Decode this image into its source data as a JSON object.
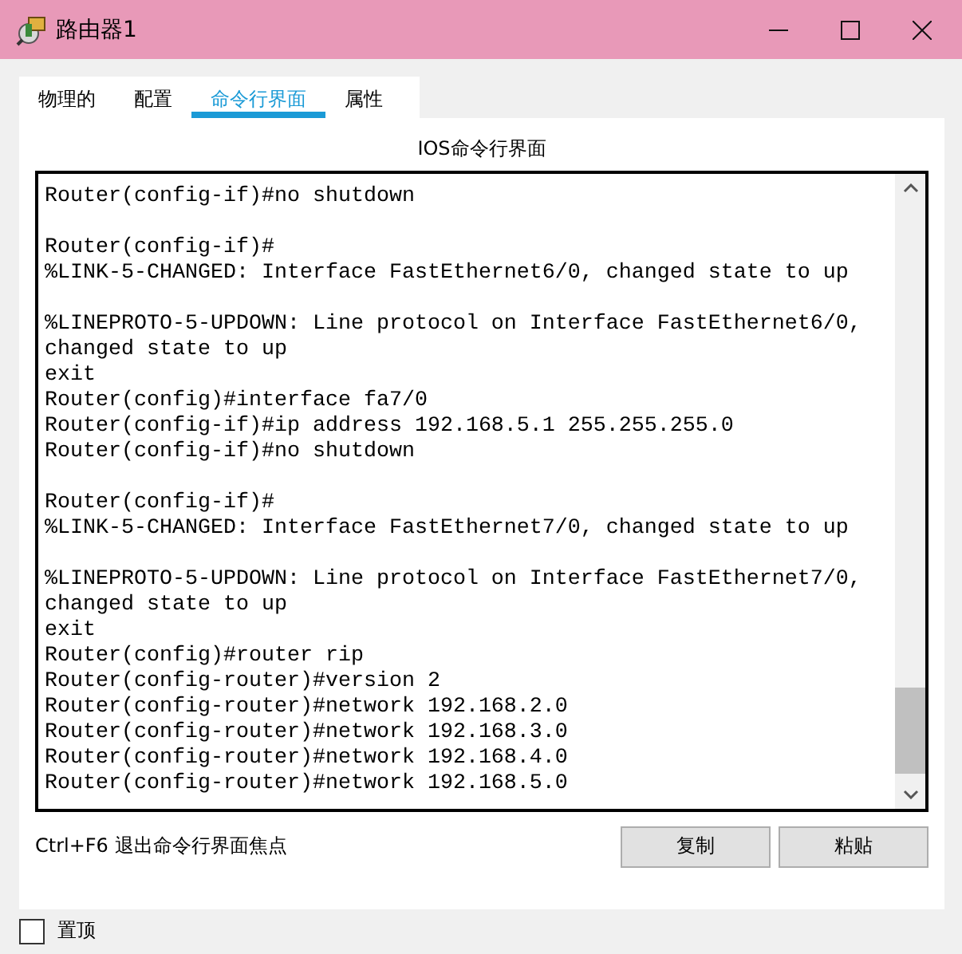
{
  "window": {
    "title": "路由器1"
  },
  "tabs": [
    {
      "label": "物理的",
      "selected": false
    },
    {
      "label": "配置",
      "selected": false
    },
    {
      "label": "命令行界面",
      "selected": true
    },
    {
      "label": "属性",
      "selected": false
    }
  ],
  "panel_title": "IOS命令行界面",
  "console_blocks": [
    [
      "Router(config-if)#no shutdown"
    ],
    [
      "Router(config-if)#",
      "%LINK-5-CHANGED: Interface FastEthernet6/0, changed state to up"
    ],
    [
      "%LINEPROTO-5-UPDOWN: Line protocol on Interface FastEthernet6/0,",
      "changed state to up",
      "exit",
      "Router(config)#interface fa7/0",
      "Router(config-if)#ip address 192.168.5.1 255.255.255.0",
      "Router(config-if)#no shutdown"
    ],
    [
      "Router(config-if)#",
      "%LINK-5-CHANGED: Interface FastEthernet7/0, changed state to up"
    ],
    [
      "%LINEPROTO-5-UPDOWN: Line protocol on Interface FastEthernet7/0,",
      "changed state to up",
      "exit",
      "Router(config)#router rip",
      "Router(config-router)#version 2",
      "Router(config-router)#network 192.168.2.0",
      "Router(config-router)#network 192.168.3.0",
      "Router(config-router)#network 192.168.4.0",
      "Router(config-router)#network 192.168.5.0"
    ]
  ],
  "hint": "Ctrl+F6 退出命令行界面焦点",
  "buttons": [
    "复制",
    "粘贴"
  ],
  "always_on_top": {
    "label": "置顶",
    "checked": false
  }
}
